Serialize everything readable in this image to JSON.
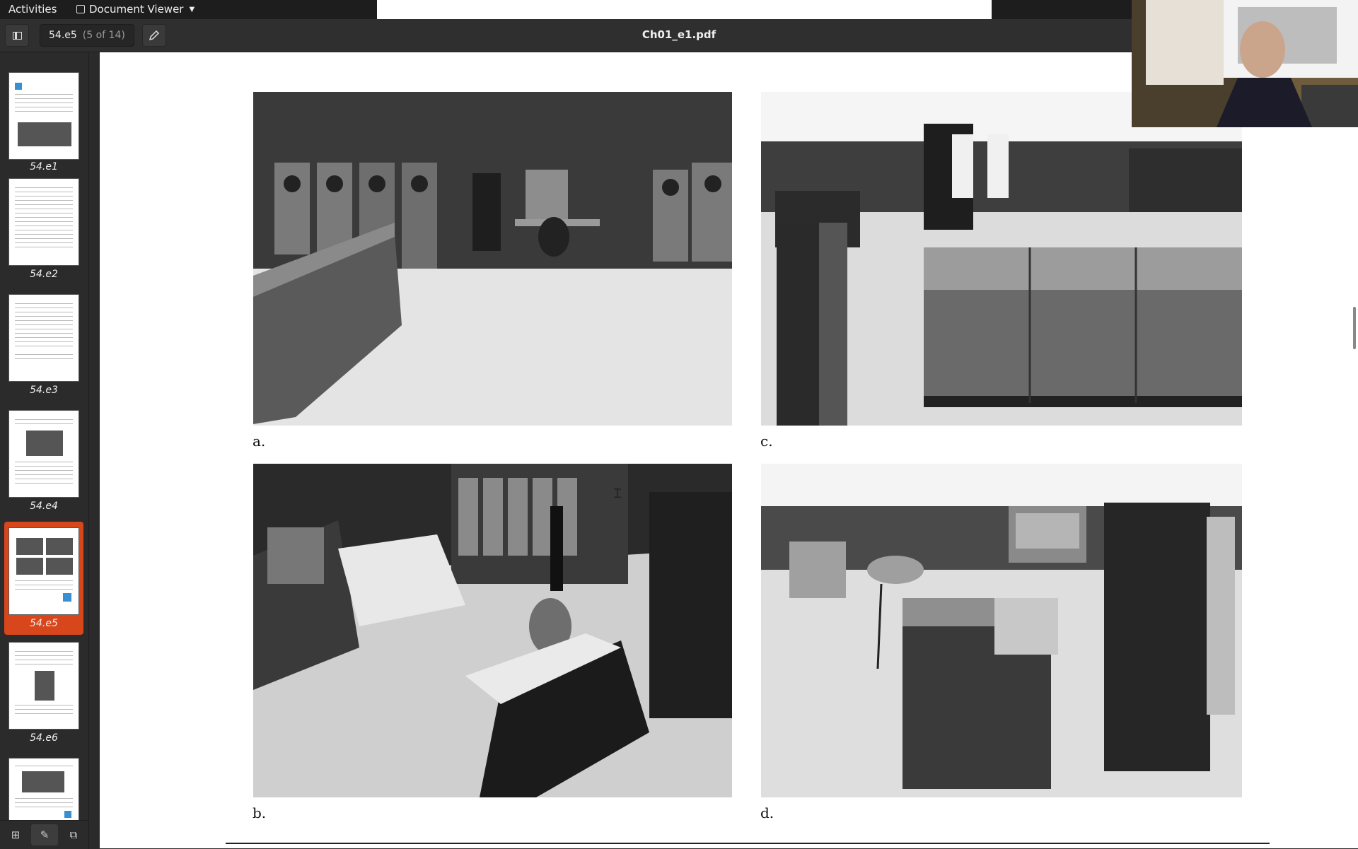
{
  "topbar": {
    "activities": "Activities",
    "app_name": "Document Viewer"
  },
  "headerbar": {
    "page_label": "54.e5",
    "page_of": "(5 of 14)",
    "title": "Ch01_e1.pdf"
  },
  "sidebar": {
    "thumbnails": [
      {
        "label": "54.e1"
      },
      {
        "label": "54.e2"
      },
      {
        "label": "54.e3"
      },
      {
        "label": "54.e4"
      },
      {
        "label": "54.e5",
        "selected": true
      },
      {
        "label": "54.e6"
      },
      {
        "label": ""
      }
    ],
    "bottom_icons": [
      "grid-icon",
      "edit-icon",
      "bookmark-icon"
    ]
  },
  "document": {
    "captions": {
      "a": "a.",
      "b": "b.",
      "c": "c.",
      "d": "d."
    }
  },
  "colors": {
    "selected_accent": "#d8471c",
    "chrome": "#2b2b2b"
  }
}
